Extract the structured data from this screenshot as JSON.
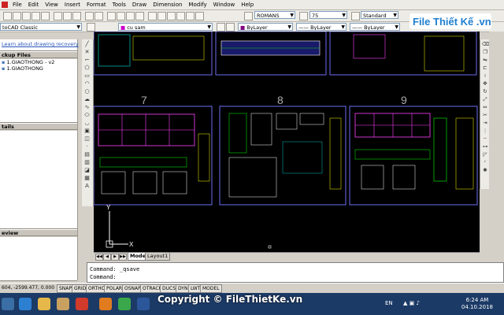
{
  "menu": [
    "File",
    "Edit",
    "View",
    "Insert",
    "Format",
    "Tools",
    "Draw",
    "Dimension",
    "Modify",
    "Window",
    "Help"
  ],
  "toolbar": {
    "textstyle": "ROMANS",
    "dimscale": "75",
    "dimstyle": "Standard",
    "workspace": "toCAD Classic",
    "layer": "cu sam",
    "color": "ByLayer",
    "linetype": "ByLayer",
    "lineweight": "ByLayer"
  },
  "logo": {
    "text": "File Thiết Kế .vn"
  },
  "leftpanel": {
    "link": "Learn about drawing recovery",
    "backup_header": "ckup Files",
    "files": [
      "1.GIAOTHONG - v2",
      "1.GIAOTHONG"
    ],
    "details_header": "tails",
    "preview_header": "eview"
  },
  "canvas": {
    "sheet_numbers": [
      "7",
      "8",
      "9"
    ],
    "ucs_x": "X",
    "ucs_y": "Y"
  },
  "tabs": {
    "model": "Model",
    "layout": "Layout1"
  },
  "command": {
    "line1": "Command:  _qsave",
    "line2": "Command:"
  },
  "status": {
    "coords": "604, -2599.477, 0.000",
    "buttons": [
      "SNAP",
      "GRID",
      "ORTHO",
      "POLAR",
      "OSNAP",
      "OTRACK",
      "DUCS",
      "DYN",
      "LWT",
      "MODEL"
    ]
  },
  "taskbar": {
    "watermark": "Copyright © FileThietKe.vn",
    "lang": "EN",
    "time": "6:24 AM",
    "date": "04.10.2018"
  },
  "colors": {
    "canvas": "#000000",
    "accent_cad": "#ffff00",
    "frame": "#6e6ef0",
    "taskbar": "#1c3a66"
  }
}
